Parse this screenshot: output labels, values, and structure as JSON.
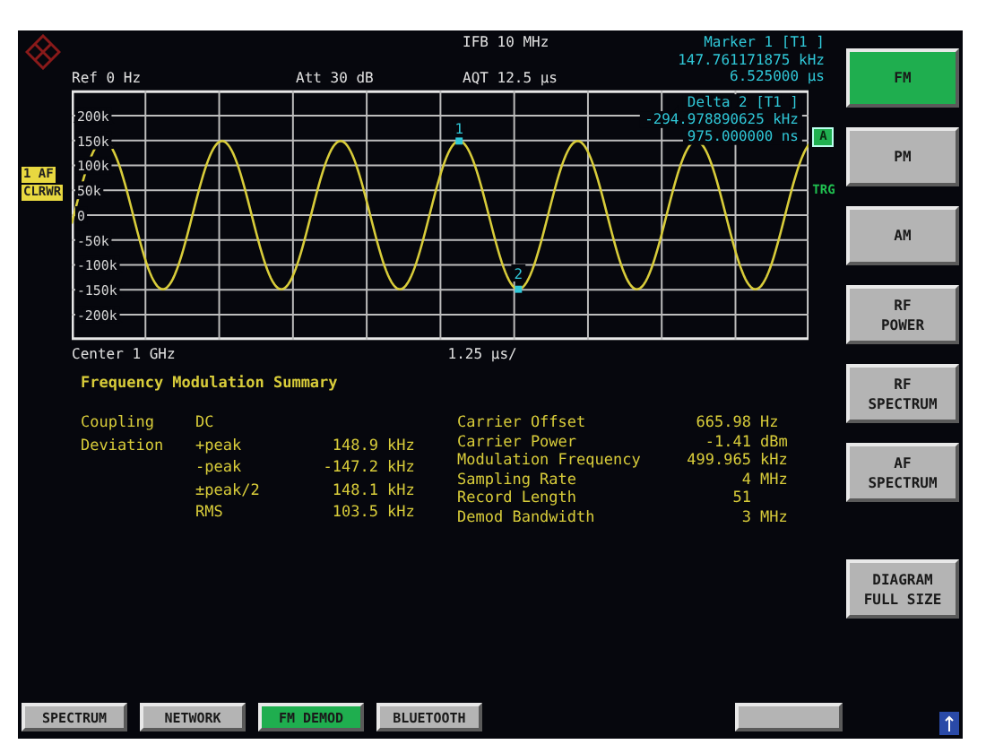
{
  "header": {
    "ref": "Ref  0 Hz",
    "att": "Att  30 dB",
    "ifb": "IFB 10 MHz",
    "aqt": "AQT 12.5 µs",
    "marker_lines": [
      "Marker 1 [T1 ]",
      "147.761171875 kHz",
      "6.525000 µs"
    ]
  },
  "trace_badges": [
    "1 AF",
    "CLRWR"
  ],
  "plot": {
    "ytick_labels": [
      "200k",
      "150k",
      "100k",
      "50k",
      "0",
      "-50k",
      "-100k",
      "-150k",
      "-200k"
    ],
    "delta_lines": [
      "Delta 2 [T1 ]",
      "-294.978890625 kHz",
      "975.000000 ns"
    ],
    "markers": [
      {
        "label": "1"
      },
      {
        "label": "2"
      }
    ],
    "trace_badge": "A",
    "trigger": "TRG"
  },
  "footer": {
    "center": "Center 1 GHz",
    "scale": "1.25 µs/"
  },
  "summary": {
    "title": "Frequency Modulation Summary",
    "left_rows": [
      {
        "label": "Coupling",
        "item": "DC"
      },
      {
        "label": "Deviation",
        "item": "+peak",
        "value": "148.9",
        "unit": "kHz"
      },
      {
        "item": "-peak",
        "value": "-147.2",
        "unit": "kHz"
      },
      {
        "item": "±peak/2",
        "value": "148.1",
        "unit": "kHz"
      },
      {
        "item": "RMS",
        "value": "103.5",
        "unit": "kHz"
      }
    ],
    "right_rows": [
      {
        "label": "Carrier Offset",
        "value": "665.98",
        "unit": "Hz"
      },
      {
        "label": "Carrier Power",
        "value": "-1.41",
        "unit": "dBm"
      },
      {
        "label": "Modulation Frequency",
        "value": "499.965",
        "unit": "kHz"
      },
      {
        "label": "Sampling Rate",
        "value": "4",
        "unit": "MHz"
      },
      {
        "label": "Record Length",
        "value": "51"
      },
      {
        "label": "Demod Bandwidth",
        "value": "3",
        "unit": "MHz"
      }
    ]
  },
  "softkeys": [
    {
      "label": "FM",
      "selected": true
    },
    {
      "label": "PM",
      "selected": false
    },
    {
      "label": "AM",
      "selected": false
    },
    {
      "label": "RF\nPOWER",
      "selected": false
    },
    {
      "label": "RF\nSPECTRUM",
      "selected": false
    },
    {
      "label": "AF\nSPECTRUM",
      "selected": false
    }
  ],
  "softkey_bottom": {
    "label": "DIAGRAM\nFULL SIZE"
  },
  "bottom_tabs": [
    {
      "label": "SPECTRUM",
      "selected": false
    },
    {
      "label": "NETWORK",
      "selected": false
    },
    {
      "label": "FM DEMOD",
      "selected": true
    },
    {
      "label": "BLUETOOTH",
      "selected": false
    }
  ]
}
